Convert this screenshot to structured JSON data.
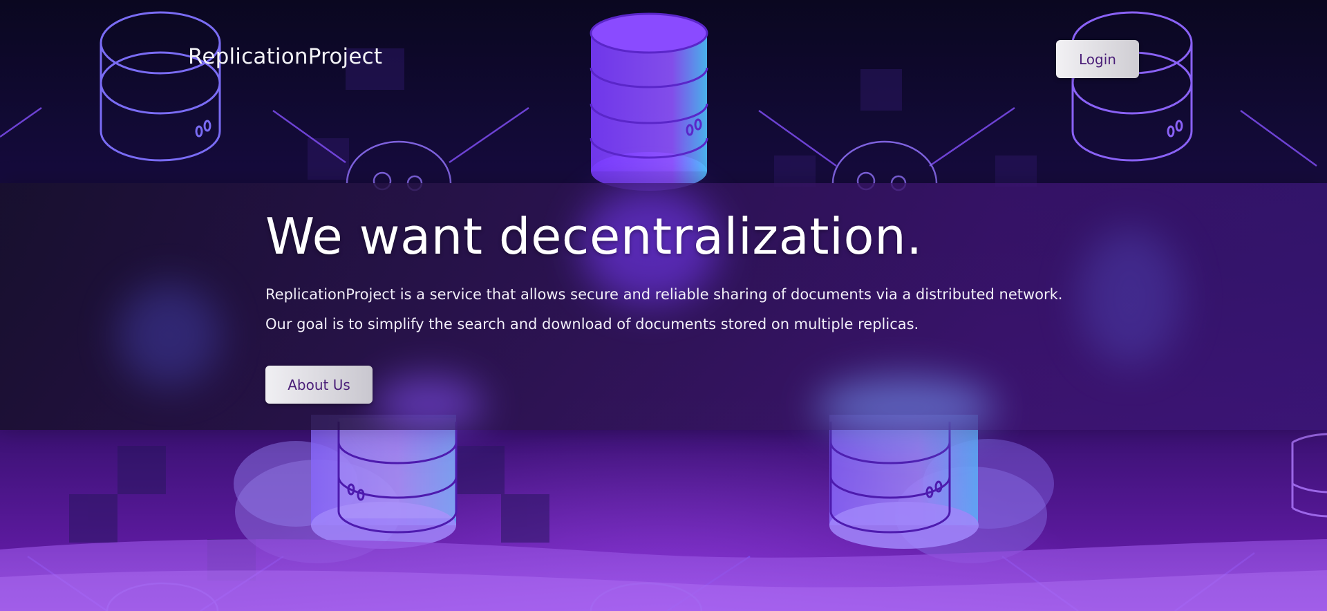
{
  "header": {
    "brand": "ReplicationProject",
    "login_label": "Login"
  },
  "hero": {
    "title": "We want decentralization.",
    "description": "ReplicationProject is a service that allows secure and reliable sharing of documents via a distributed network. Our goal is to simplify the search and download of documents stored on multiple replicas.",
    "about_label": "About Us"
  },
  "colors": {
    "background_top": "#0a0720",
    "background_bottom": "#6a22b0",
    "accent_purple": "#8a3cff",
    "accent_blue": "#5a8cff",
    "button_text": "#4a1e78"
  },
  "icons": [
    "database-icon",
    "gear-icon",
    "network-line-icon"
  ]
}
